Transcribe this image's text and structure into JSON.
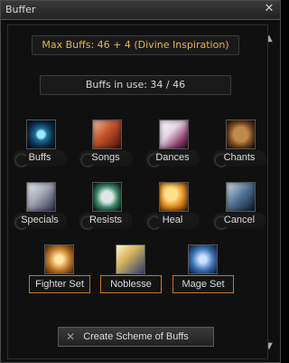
{
  "window": {
    "title": "Buffer",
    "close_icon": "✕",
    "scroll_up_icon": "▲",
    "scroll_down_icon": "▼"
  },
  "info": {
    "max_buffs": "Max Buffs: 46 + 4 (Divine Inspiration)",
    "buffs_in_use": "Buffs in use:  34 / 46"
  },
  "categories": [
    {
      "label": "Buffs",
      "icon": "buffs-icon"
    },
    {
      "label": "Songs",
      "icon": "songs-icon"
    },
    {
      "label": "Dances",
      "icon": "dances-icon"
    },
    {
      "label": "Chants",
      "icon": "chants-icon"
    },
    {
      "label": "Specials",
      "icon": "specials-icon"
    },
    {
      "label": "Resists",
      "icon": "resists-icon"
    },
    {
      "label": "Heal",
      "icon": "heal-icon"
    },
    {
      "label": "Cancel",
      "icon": "cancel-icon"
    }
  ],
  "sets": [
    {
      "label": "Fighter Set",
      "icon": "fighter-set-icon"
    },
    {
      "label": "Noblesse",
      "icon": "noblesse-icon"
    },
    {
      "label": "Mage Set",
      "icon": "mage-set-icon"
    }
  ],
  "footer": {
    "create_scheme_label": "Create Scheme of Buffs",
    "scheme_icon": "crossed-swords-icon"
  },
  "colors": {
    "accent": "#e8b542",
    "set_button_border": "#c77a1a"
  }
}
